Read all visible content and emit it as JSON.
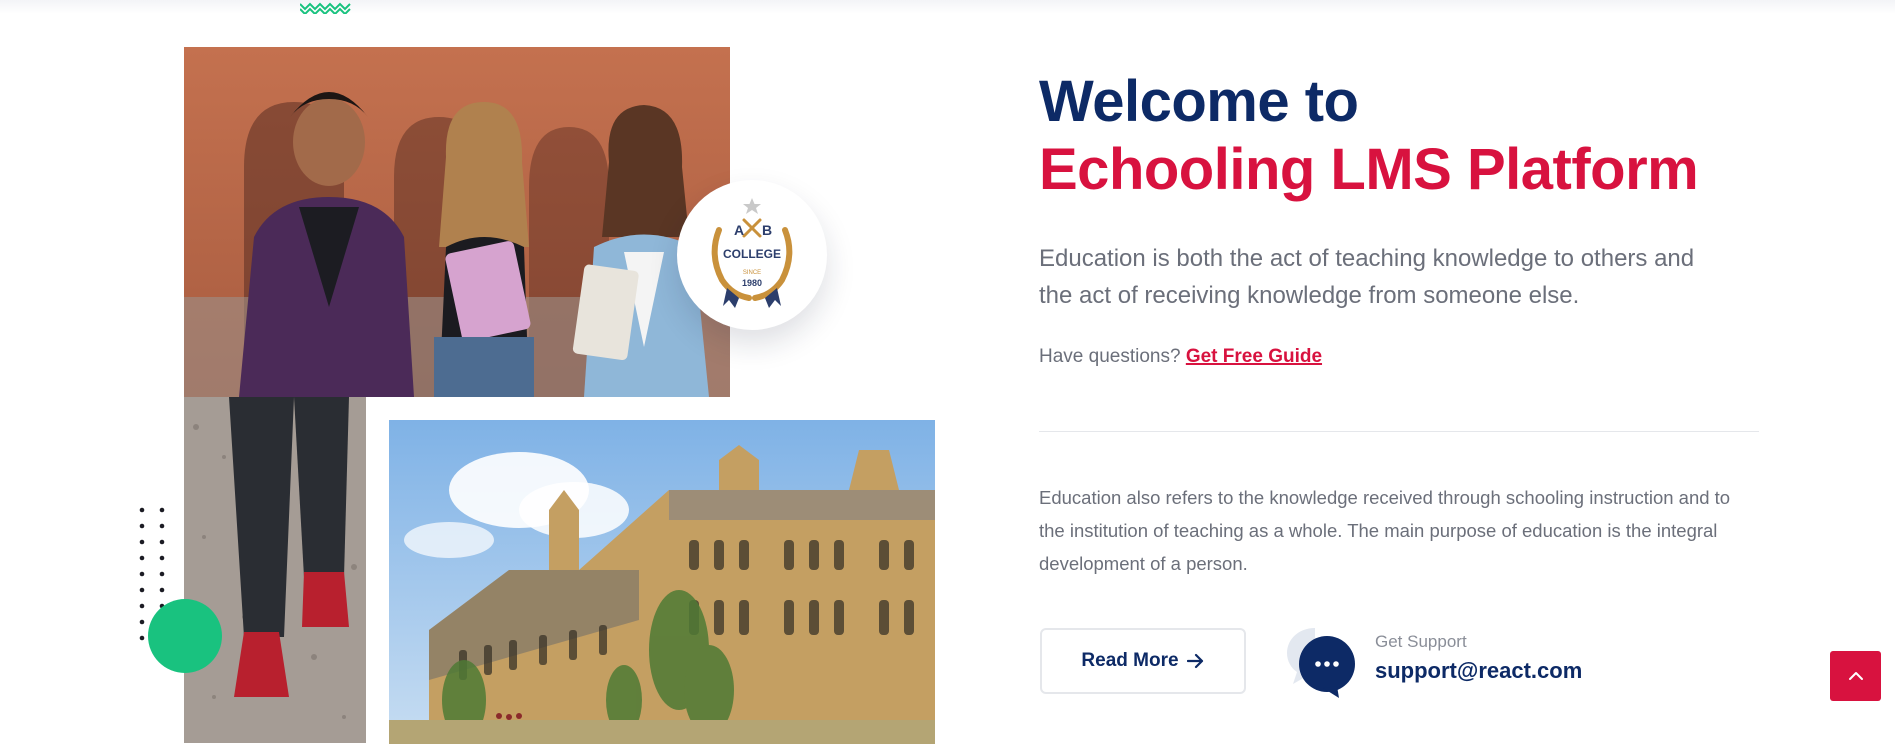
{
  "hero": {
    "title_line1": "Welcome to",
    "title_line2": "Echooling LMS Platform",
    "lead": "Education is both the act of teaching knowledge to others and the act of receiving knowledge from someone else.",
    "question_prefix": "Have questions?",
    "guide_link": "Get Free Guide",
    "body": "Education also refers to the knowledge received through schooling instruction and to the institution of teaching as a whole. The main purpose of education is the integral development of a person.",
    "read_more_label": "Read More"
  },
  "support": {
    "label": "Get Support",
    "email": "support@react.com"
  },
  "badge": {
    "letter_left": "A",
    "letter_right": "B",
    "word": "COLLEGE",
    "since": "SINCE",
    "year": "1980"
  },
  "colors": {
    "navy": "#0d2a66",
    "crimson": "#d8123f",
    "green": "#19c27f",
    "gold": "#c9913b"
  },
  "icons": [
    "zigzag-decoration",
    "arrow-right-icon",
    "chat-bubble-icon",
    "chevron-up-icon"
  ]
}
